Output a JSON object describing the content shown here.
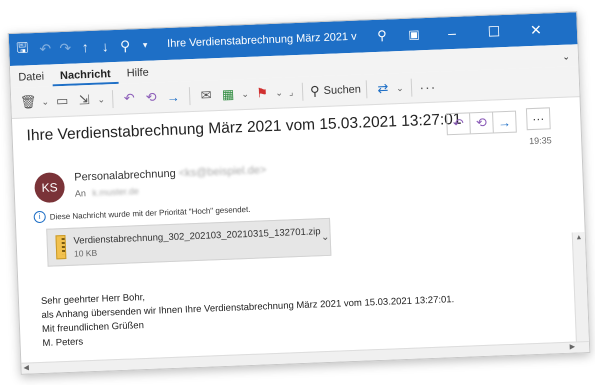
{
  "titlebar": {
    "title": "Ihre Verdienstabrechnung März 2021 vom...",
    "icons": [
      "save-icon",
      "undo-icon",
      "redo-icon",
      "arrow-up-icon",
      "arrow-down-icon",
      "quick-access-icon",
      "customize-icon",
      "search-icon",
      "coming-soon-icon",
      "minimize-icon",
      "maximize-icon",
      "close-icon"
    ],
    "accent": "#1e6fc6"
  },
  "menu": {
    "tabs": [
      "Datei",
      "Nachricht",
      "Hilfe"
    ],
    "active": "Nachricht"
  },
  "ribbon": {
    "search_label": "Suchen",
    "more": "···"
  },
  "message": {
    "subject": "Ihre Verdienstabrechnung März 2021 vom 15.03.2021 13:27:01",
    "time": "19:35",
    "avatar_initials": "KS",
    "avatar_color": "#7a3338",
    "sender_name": "Personalabrechnung",
    "sender_email": "<ks@beispiel.de>",
    "to_label": "An",
    "to_value": "k.muster.de",
    "priority_note": "Diese Nachricht wurde mit der Priorität \"Hoch\" gesendet.",
    "attachment": {
      "name": "Verdienstabrechnung_302_202103_20210315_132701.zip",
      "size": "10 KB"
    },
    "body": [
      "Sehr geehrter Herr  Bohr,",
      "als Anhang übersenden wir Ihnen Ihre Verdienstabrechnung März 2021 vom 15.03.2021 13:27:01.",
      "Mit freundlichen Grüßen",
      "M. Peters"
    ]
  }
}
